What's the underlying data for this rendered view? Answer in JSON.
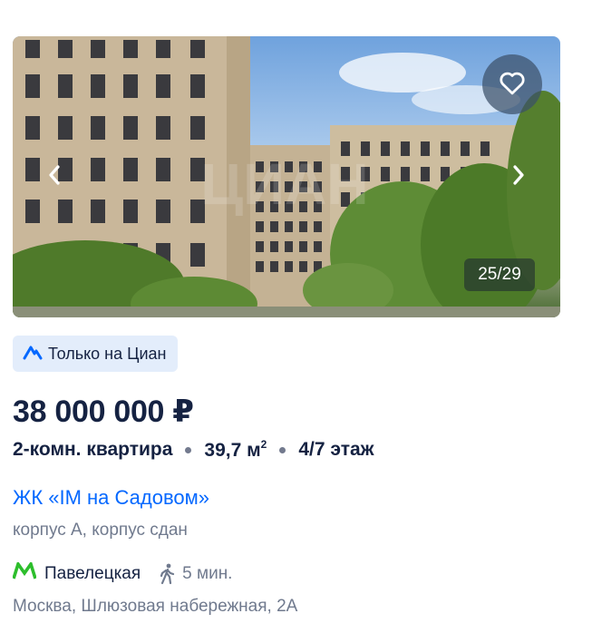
{
  "listing": {
    "gallery": {
      "counter": "25/29",
      "watermark": "ЦИАН"
    },
    "badge_label": "Только на Циан",
    "price": "38 000 000 ₽",
    "specs": {
      "rooms": "2-комн. квартира",
      "area": "39,7 м",
      "area_sup": "2",
      "floor": "4/7 этаж"
    },
    "complex_name": "ЖК «IM на Садовом»",
    "building_info": "корпус А, корпус сдан",
    "metro": {
      "station": "Павелецкая",
      "walk_time": "5 мин.",
      "line_color": "#2dbe2c"
    },
    "address": "Москва, Шлюзовая набережная, 2А"
  },
  "colors": {
    "accent": "#0468ff",
    "badge_bg": "#e3edfb",
    "text_primary": "#152242",
    "text_secondary": "#707a8e"
  },
  "icons": [
    "heart-icon",
    "chevron-left-icon",
    "chevron-right-icon",
    "cian-logo-icon",
    "metro-icon",
    "walk-icon"
  ]
}
